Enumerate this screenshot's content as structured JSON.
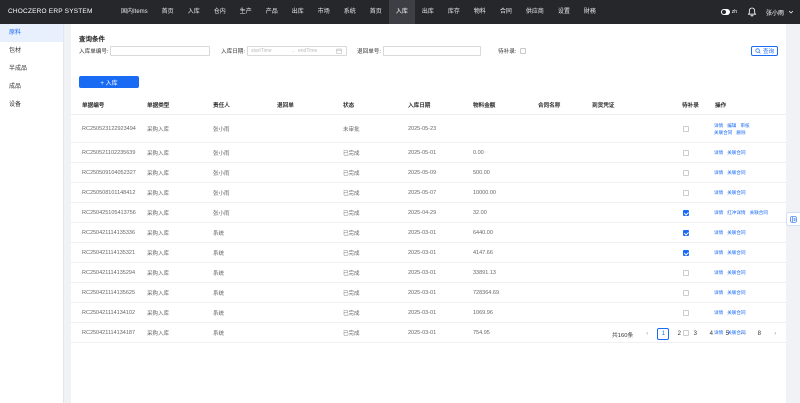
{
  "app": {
    "title": "CHOCZERO ERP SYSTEM"
  },
  "nav": [
    "国内Items",
    "首页",
    "入库",
    "仓内",
    "生产",
    "产品",
    "出库",
    "市场",
    "系统",
    "首页",
    "入库",
    "出库",
    "库存",
    "物料",
    "合同",
    "供应商",
    "设置",
    "財務"
  ],
  "nav_active": 10,
  "topright": {
    "lang": "zh",
    "user": "张小雨"
  },
  "sidebar": [
    "原料",
    "包材",
    "半成品",
    "成品",
    "设备"
  ],
  "sidebar_active": 0,
  "query": {
    "title": "查询条件",
    "inbound_no_label": "入库单编号:",
    "date_label": "入库日期:",
    "start_placeholder": "startTime",
    "range_sep": "→",
    "end_placeholder": "endTime",
    "return_no_label": "退回单号:",
    "pending_label": "待补录:",
    "search_label": "查询"
  },
  "add_button": "+ 入库",
  "columns": [
    "单据编号",
    "单据类型",
    "责任人",
    "退回单",
    "状态",
    "入库日期",
    "物料金额",
    "合同名称",
    "到货凭证",
    "待补录",
    "操作"
  ],
  "rows": [
    {
      "id": "RC25052312292349​4",
      "type": "采购入库",
      "owner": "张小雨",
      "ret": "",
      "status": "未审批",
      "date": "2025-05-23",
      "amount": "",
      "checked": false,
      "actions": [
        "详情",
        "编辑",
        "审核",
        "关联合同",
        "删除"
      ]
    },
    {
      "id": "RC250521102235639",
      "type": "采购入库",
      "owner": "张小雨",
      "ret": "",
      "status": "已完成",
      "date": "2025-05-01",
      "amount": "0.00",
      "checked": false,
      "actions": [
        "详情",
        "关联合同"
      ]
    },
    {
      "id": "RC250509104052327",
      "type": "采购入库",
      "owner": "张小雨",
      "ret": "",
      "status": "已完成",
      "date": "2025-05-09",
      "amount": "500.00",
      "checked": false,
      "actions": [
        "详情",
        "关联合同"
      ]
    },
    {
      "id": "RC250508101148412",
      "type": "采购入库",
      "owner": "张小雨",
      "ret": "",
      "status": "已完成",
      "date": "2025-05-07",
      "amount": "10000.00",
      "checked": false,
      "actions": [
        "详情",
        "关联合同"
      ]
    },
    {
      "id": "RC250425105413756",
      "type": "采购入库",
      "owner": "张小雨",
      "ret": "",
      "status": "已完成",
      "date": "2025-04-29",
      "amount": "32.00",
      "checked": true,
      "actions": [
        "详情",
        "红冲详情",
        "关联合同"
      ]
    },
    {
      "id": "RC250421114135336",
      "type": "采购入库",
      "owner": "系统",
      "ret": "",
      "status": "已完成",
      "date": "2025-03-01",
      "amount": "6440.00",
      "checked": true,
      "actions": [
        "详情",
        "关联合同"
      ]
    },
    {
      "id": "RC250421114135321",
      "type": "采购入库",
      "owner": "系统",
      "ret": "",
      "status": "已完成",
      "date": "2025-03-01",
      "amount": "4147.66",
      "checked": true,
      "actions": [
        "详情",
        "关联合同"
      ]
    },
    {
      "id": "RC250421114135294",
      "type": "采购入库",
      "owner": "系统",
      "ret": "",
      "status": "已完成",
      "date": "2025-03-01",
      "amount": "33891.13",
      "checked": false,
      "actions": [
        "详情",
        "关联合同"
      ]
    },
    {
      "id": "RC250421114135625",
      "type": "采购入库",
      "owner": "系统",
      "ret": "",
      "status": "已完成",
      "date": "2025-03-01",
      "amount": "728364.69",
      "checked": false,
      "actions": [
        "详情",
        "关联合同"
      ]
    },
    {
      "id": "RC250421114134102",
      "type": "采购入库",
      "owner": "系统",
      "ret": "",
      "status": "已完成",
      "date": "2025-03-01",
      "amount": "1069.96",
      "checked": false,
      "actions": [
        "详情",
        "关联合同"
      ]
    },
    {
      "id": "RC250421114134187",
      "type": "采购入库",
      "owner": "系统",
      "ret": "",
      "status": "已完成",
      "date": "2025-03-01",
      "amount": "754.95",
      "checked": false,
      "actions": [
        "详情",
        "关联合同"
      ]
    }
  ],
  "pagination": {
    "total": "共160条",
    "prev": "‹",
    "pages": [
      "1",
      "2",
      "3",
      "4",
      "5",
      "···",
      "8"
    ],
    "active": "1",
    "next": "›"
  },
  "colors": {
    "accent": "#1a6bf4",
    "topbar": "#26272b"
  },
  "icons": {
    "bell": "bell-icon",
    "search": "search-icon",
    "chevron": "chevron-down-icon",
    "float": "panel-toggle-icon"
  }
}
